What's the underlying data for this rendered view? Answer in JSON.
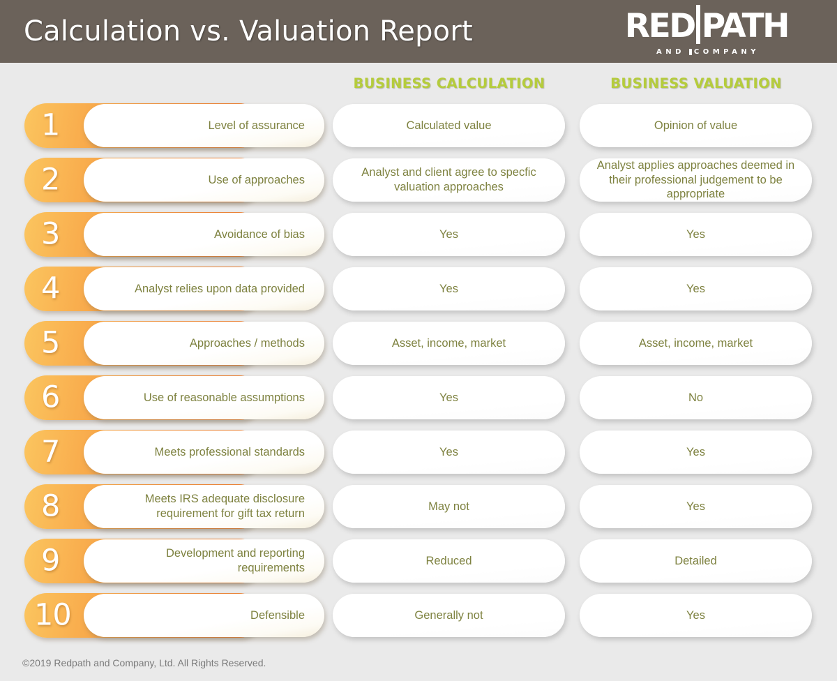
{
  "header": {
    "title": "Calculation vs. Valuation Report",
    "logo": {
      "part1": "RED",
      "part2": "PATH",
      "tagline": "AND COMPANY",
      "tagline_left": "AND",
      "tagline_right": "COMPANY"
    },
    "bar_color": "#6b625a"
  },
  "columns": {
    "calculation_heading": "BUSINESS CALCULATION",
    "valuation_heading": "BUSINESS VALUATION",
    "heading_color": "#b5cc3c"
  },
  "theme": {
    "background": "#eaeaea",
    "text_color": "#7e8240",
    "orange_light": "#fbc55f",
    "orange_dark": "#ee8034"
  },
  "rows": [
    {
      "number": "1",
      "criterion": "Level of assurance",
      "calculation": "Calculated value",
      "valuation": "Opinion of value"
    },
    {
      "number": "2",
      "criterion": "Use of approaches",
      "calculation": "Analyst and client agree to specfic valuation approaches",
      "valuation": "Analyst applies approaches deemed in their professional judgement to be appropriate"
    },
    {
      "number": "3",
      "criterion": "Avoidance of bias",
      "calculation": "Yes",
      "valuation": "Yes"
    },
    {
      "number": "4",
      "criterion": "Analyst relies upon data provided",
      "calculation": "Yes",
      "valuation": "Yes"
    },
    {
      "number": "5",
      "criterion": "Approaches / methods",
      "calculation": "Asset, income, market",
      "valuation": "Asset, income, market"
    },
    {
      "number": "6",
      "criterion": "Use of reasonable assumptions",
      "calculation": "Yes",
      "valuation": "No"
    },
    {
      "number": "7",
      "criterion": "Meets professional standards",
      "calculation": "Yes",
      "valuation": "Yes"
    },
    {
      "number": "8",
      "criterion": "Meets IRS adequate disclosure requirement for gift tax return",
      "calculation": "May not",
      "valuation": "Yes"
    },
    {
      "number": "9",
      "criterion": "Development and reporting requirements",
      "calculation": "Reduced",
      "valuation": "Detailed"
    },
    {
      "number": "10",
      "criterion": "Defensible",
      "calculation": "Generally not",
      "valuation": "Yes"
    }
  ],
  "footer": {
    "copyright": "©2019 Redpath and Company, Ltd. All Rights Reserved."
  }
}
